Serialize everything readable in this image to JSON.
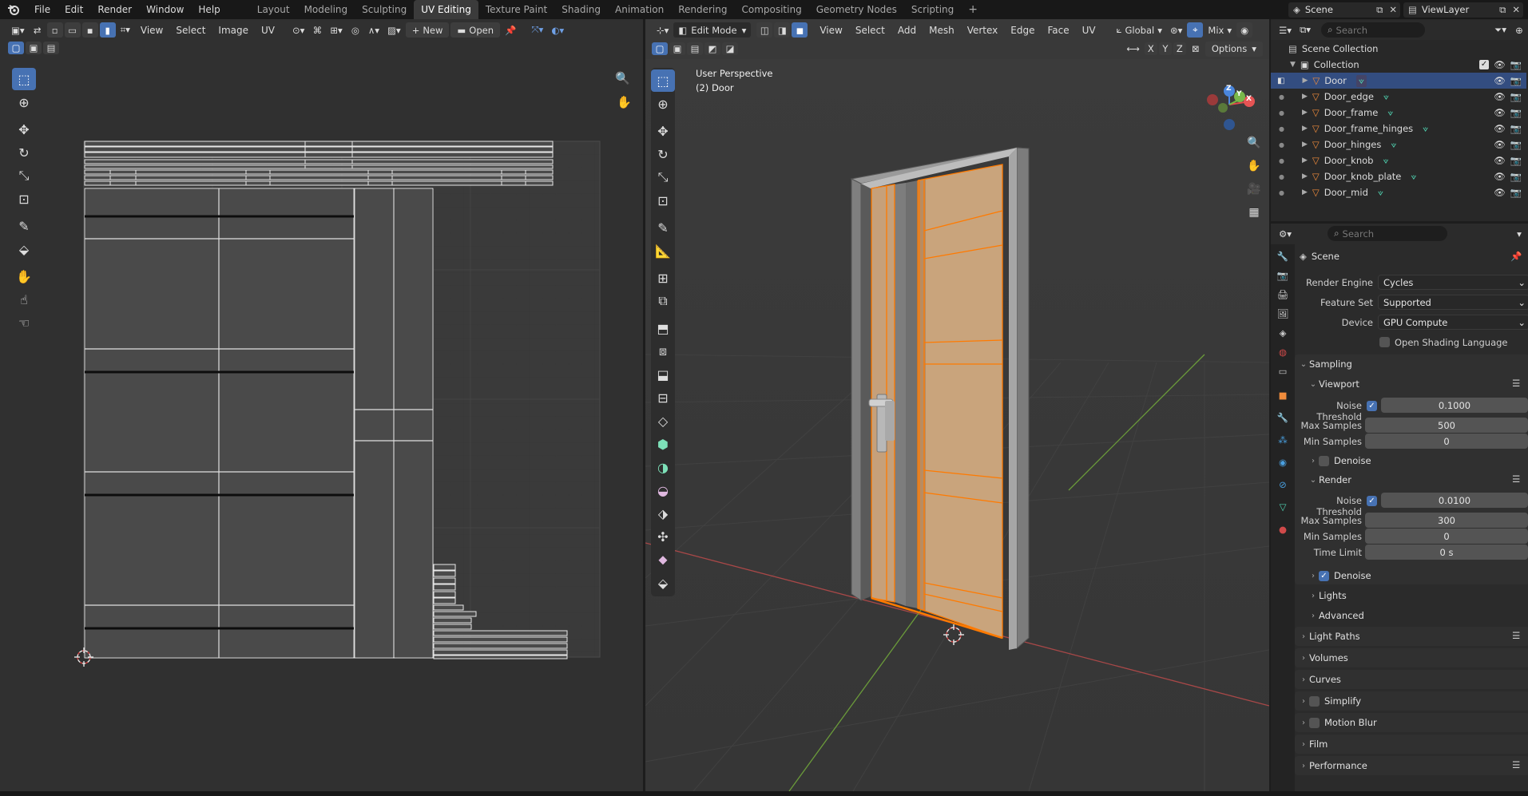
{
  "topbar": {
    "menus": [
      "File",
      "Edit",
      "Render",
      "Window",
      "Help"
    ],
    "workspaces": [
      "Layout",
      "Modeling",
      "Sculpting",
      "UV Editing",
      "Texture Paint",
      "Shading",
      "Animation",
      "Rendering",
      "Compositing",
      "Geometry Nodes",
      "Scripting"
    ],
    "active_workspace": "UV Editing",
    "add_tab": "+",
    "scene_name": "Scene",
    "view_layer": "ViewLayer"
  },
  "uv_editor": {
    "menus": [
      "View",
      "Select",
      "Image",
      "UV"
    ],
    "new_label": "New",
    "open_label": "Open"
  },
  "viewport": {
    "mode": "Edit Mode",
    "menus": [
      "View",
      "Select",
      "Add",
      "Mesh",
      "Vertex",
      "Edge",
      "Face",
      "UV"
    ],
    "orientation": "Global",
    "shading": "Mix",
    "axes": [
      "X",
      "Y",
      "Z"
    ],
    "options_label": "Options",
    "overlay_title": "User Perspective",
    "overlay_object": "(2) Door",
    "gizmo_z": "Z",
    "gizmo_y": "Y",
    "gizmo_x": "X"
  },
  "outliner": {
    "search_placeholder": "Search",
    "scene_collection": "Scene Collection",
    "collection": "Collection",
    "objects": [
      "Door",
      "Door_edge",
      "Door_frame",
      "Door_frame_hinges",
      "Door_hinges",
      "Door_knob",
      "Door_knob_plate",
      "Door_mid"
    ]
  },
  "properties": {
    "search_placeholder": "Search",
    "context": "Scene",
    "render_engine_label": "Render Engine",
    "render_engine": "Cycles",
    "feature_set_label": "Feature Set",
    "feature_set": "Supported",
    "device_label": "Device",
    "device": "GPU Compute",
    "osl_label": "Open Shading Language",
    "sampling": "Sampling",
    "viewport": "Viewport",
    "noise_threshold_label": "Noise Threshold",
    "vp_noise_threshold": "0.1000",
    "max_samples_label": "Max Samples",
    "vp_max_samples": "500",
    "min_samples_label": "Min Samples",
    "vp_min_samples": "0",
    "denoise_label": "Denoise",
    "render": "Render",
    "r_noise_threshold": "0.0100",
    "r_max_samples": "300",
    "r_min_samples": "0",
    "time_limit_label": "Time Limit",
    "r_time_limit": "0 s",
    "lights": "Lights",
    "advanced": "Advanced",
    "light_paths": "Light Paths",
    "volumes": "Volumes",
    "curves": "Curves",
    "simplify": "Simplify",
    "motion_blur": "Motion Blur",
    "film": "Film",
    "performance": "Performance"
  },
  "colors": {
    "accent": "#4772b3",
    "selection": "#ff8a00",
    "door_face": "#c8a47c",
    "frame": "#8a8a8a"
  }
}
